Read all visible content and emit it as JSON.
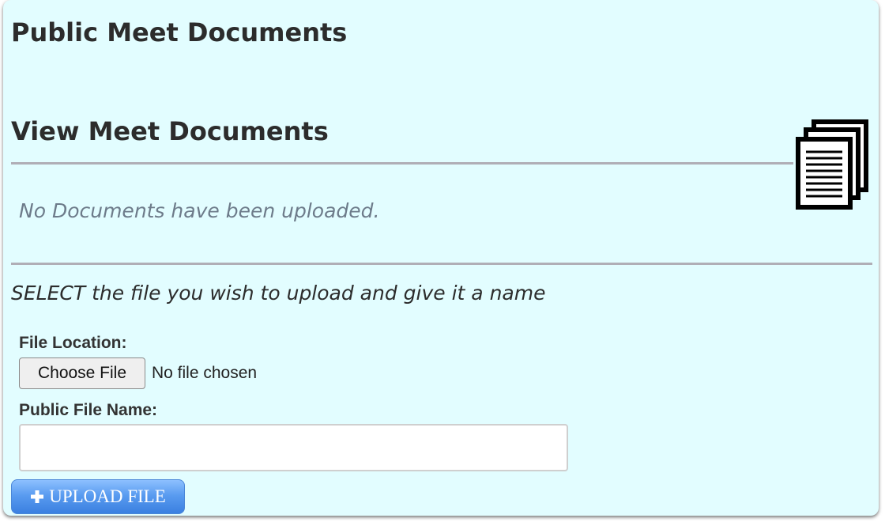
{
  "header": {
    "title": "Public Meet Documents"
  },
  "documents": {
    "section_title": "View Meet Documents",
    "empty_message": "No Documents have been uploaded.",
    "icon": "documents-stack-icon"
  },
  "upload_form": {
    "instructions": "SELECT the file you wish to upload and give it a name",
    "file_location_label": "File Location:",
    "choose_file_label": "Choose File",
    "file_status": "No file chosen",
    "public_file_name_label": "Public File Name:",
    "public_file_name_value": "",
    "upload_button_label": "UPLOAD FILE",
    "upload_icon": "plus-icon"
  },
  "colors": {
    "panel_background": "#e2fdff",
    "divider": "#b0aeb6",
    "upload_button": "#5a9cf0"
  }
}
